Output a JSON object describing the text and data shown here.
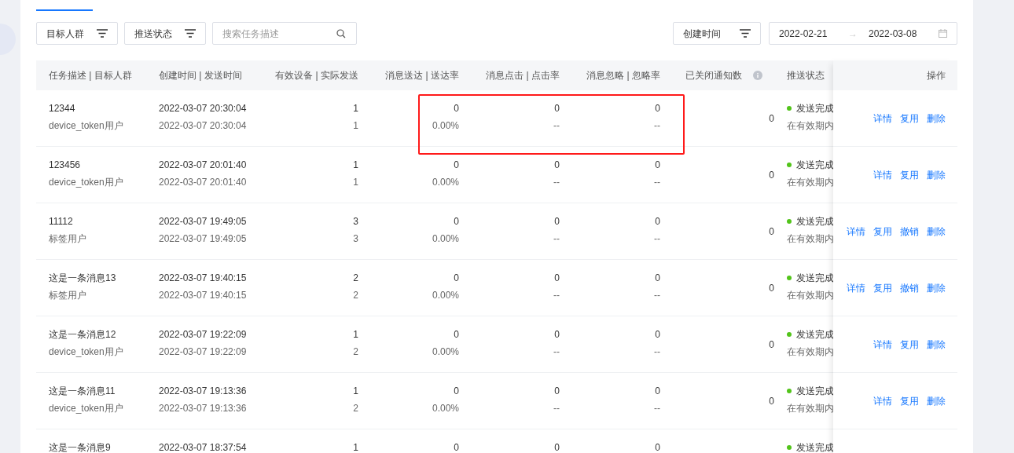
{
  "filters": [
    {
      "kind": "filter",
      "label": "目标人群"
    },
    {
      "kind": "filter",
      "label": "推送状态"
    },
    {
      "kind": "search",
      "placeholder": "搜索任务描述"
    }
  ],
  "time_filter": {
    "label": "创建时间",
    "start": "2022-02-21",
    "end": "2022-03-08",
    "separator": "→"
  },
  "table": {
    "columns": [
      {
        "label": "任务描述 | 目标人群"
      },
      {
        "label": "创建时间 | 发送时间"
      },
      {
        "label": "有效设备 | 实际发送"
      },
      {
        "label": "消息送达 | 送达率"
      },
      {
        "label": "消息点击 | 点击率"
      },
      {
        "label": "消息忽略 | 忽略率"
      },
      {
        "label": "已关闭通知数",
        "info": true
      },
      {
        "label": "推送状态"
      },
      {
        "label": "操作"
      }
    ],
    "rows": [
      {
        "cells": [
          [
            "12344",
            "device_token用户"
          ],
          [
            "2022-03-07 20:30:04",
            "2022-03-07 20:30:04"
          ],
          [
            "1",
            "1"
          ],
          [
            "0",
            "0.00%"
          ],
          [
            "0",
            "--"
          ],
          [
            "0",
            "--"
          ],
          [
            "0"
          ]
        ],
        "status": "发送完成",
        "status_note": "在有效期内",
        "actions": [
          "详情",
          "复用",
          "删除"
        ]
      },
      {
        "cells": [
          [
            "123456",
            "device_token用户"
          ],
          [
            "2022-03-07 20:01:40",
            "2022-03-07 20:01:40"
          ],
          [
            "1",
            "1"
          ],
          [
            "0",
            "0.00%"
          ],
          [
            "0",
            "--"
          ],
          [
            "0",
            "--"
          ],
          [
            "0"
          ]
        ],
        "status": "发送完成",
        "status_note": "在有效期内",
        "actions": [
          "详情",
          "复用",
          "删除"
        ]
      },
      {
        "cells": [
          [
            "11112",
            "标签用户"
          ],
          [
            "2022-03-07 19:49:05",
            "2022-03-07 19:49:05"
          ],
          [
            "3",
            "3"
          ],
          [
            "0",
            "0.00%"
          ],
          [
            "0",
            "--"
          ],
          [
            "0",
            "--"
          ],
          [
            "0"
          ]
        ],
        "status": "发送完成",
        "status_note": "在有效期内",
        "actions": [
          "详情",
          "复用",
          "撤销",
          "删除"
        ]
      },
      {
        "cells": [
          [
            "这是一条消息13",
            "标签用户"
          ],
          [
            "2022-03-07 19:40:15",
            "2022-03-07 19:40:15"
          ],
          [
            "2",
            "2"
          ],
          [
            "0",
            "0.00%"
          ],
          [
            "0",
            "--"
          ],
          [
            "0",
            "--"
          ],
          [
            "0"
          ]
        ],
        "status": "发送完成",
        "status_note": "在有效期内",
        "actions": [
          "详情",
          "复用",
          "撤销",
          "删除"
        ]
      },
      {
        "cells": [
          [
            "这是一条消息12",
            "device_token用户"
          ],
          [
            "2022-03-07 19:22:09",
            "2022-03-07 19:22:09"
          ],
          [
            "1",
            "2"
          ],
          [
            "0",
            "0.00%"
          ],
          [
            "0",
            "--"
          ],
          [
            "0",
            "--"
          ],
          [
            "0"
          ]
        ],
        "status": "发送完成",
        "status_note": "在有效期内",
        "actions": [
          "详情",
          "复用",
          "删除"
        ]
      },
      {
        "cells": [
          [
            "这是一条消息11",
            "device_token用户"
          ],
          [
            "2022-03-07 19:13:36",
            "2022-03-07 19:13:36"
          ],
          [
            "1",
            "2"
          ],
          [
            "0",
            "0.00%"
          ],
          [
            "0",
            "--"
          ],
          [
            "0",
            "--"
          ],
          [
            "0"
          ]
        ],
        "status": "发送完成",
        "status_note": "在有效期内",
        "actions": [
          "详情",
          "复用",
          "删除"
        ]
      },
      {
        "cells": [
          [
            "这是一条消息9"
          ],
          [
            "2022-03-07 18:37:54"
          ],
          [
            "1"
          ],
          [
            "0"
          ],
          [
            "0"
          ],
          [
            "0"
          ]
        ],
        "status": "发送完成"
      }
    ]
  }
}
